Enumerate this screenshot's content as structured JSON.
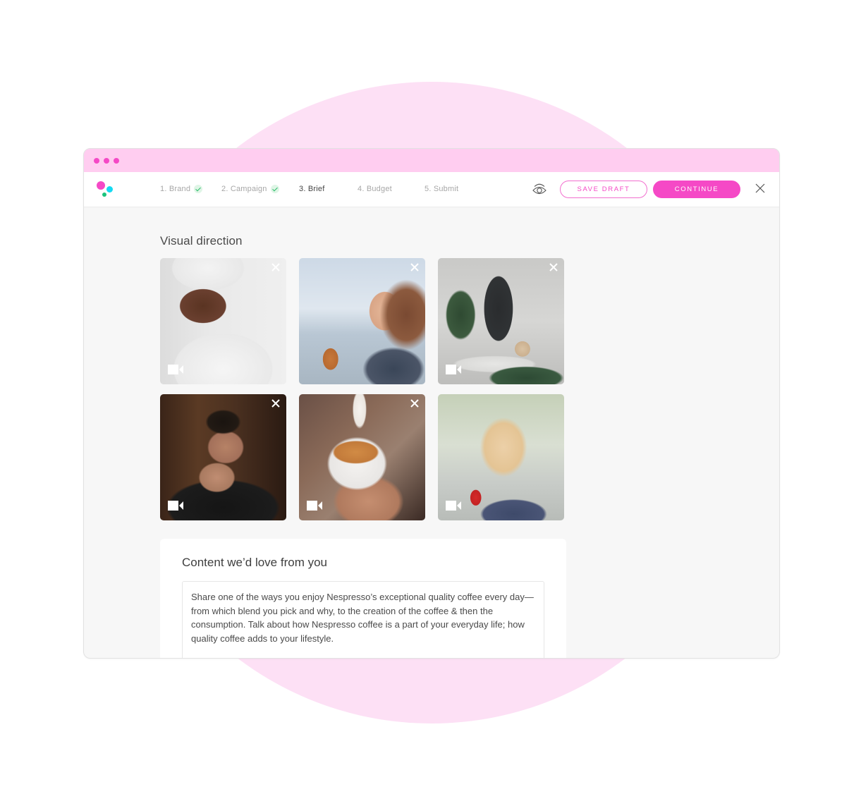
{
  "window": {
    "controls": [
      "dot",
      "dot",
      "dot"
    ]
  },
  "topnav": {
    "logo": "brand-logo",
    "steps": [
      {
        "label": "1. Brand",
        "state": "completed"
      },
      {
        "label": "2. Campaign",
        "state": "completed"
      },
      {
        "label": "3. Brief",
        "state": "active"
      },
      {
        "label": "4. Budget",
        "state": "upcoming"
      },
      {
        "label": "5. Submit",
        "state": "upcoming"
      }
    ],
    "preview_icon": "eye-icon",
    "save_draft_label": "SAVE DRAFT",
    "continue_label": "CONTINUE",
    "close_icon": "close-icon"
  },
  "visual_direction": {
    "title": "Visual direction",
    "tiles": [
      {
        "subject": "woman in white robe and towel smiling, holding coffee cup",
        "type": "video",
        "removable": true
      },
      {
        "subject": "woman by the sea drinking iced coffee through straw",
        "type": "video",
        "removable": true
      },
      {
        "subject": "coffee machine with plant and latte macchiato",
        "type": "video",
        "removable": true
      },
      {
        "subject": "man sipping coffee from glass",
        "type": "video",
        "removable": true
      },
      {
        "subject": "milk pouring into latte art cup",
        "type": "video",
        "removable": true
      },
      {
        "subject": "blonde woman smiling with red Nescafe mug",
        "type": "video",
        "removable": false
      }
    ]
  },
  "brief": {
    "title": "Content we’d love from you",
    "text": "Share one of the ways you enjoy Nespresso’s exceptional quality coffee every day—from which blend you pick and why, to the creation of the coffee & then the consumption. Talk about how Nespresso coffee is a part of your everyday life; how quality coffee adds to your lifestyle."
  },
  "colors": {
    "accent": "#f549c6",
    "titlebar": "#ffcdf0",
    "background_circle": "#fde0f5",
    "check_green": "#2ebd6b",
    "logo_cyan": "#14daf2",
    "logo_green": "#1bc47d"
  }
}
